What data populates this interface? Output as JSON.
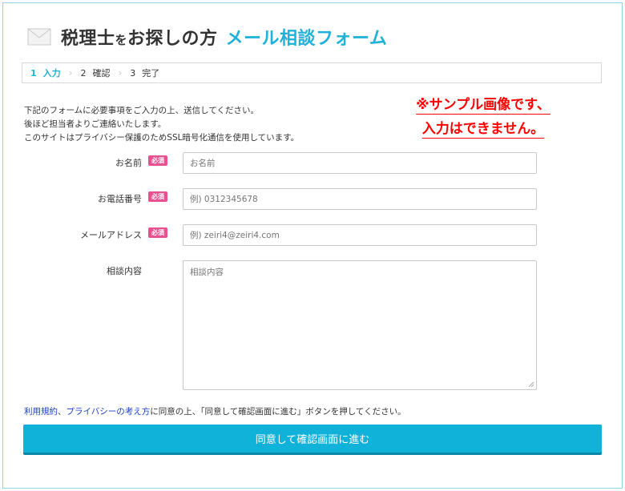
{
  "header": {
    "icon": "mail-icon",
    "title_main": "税理士",
    "title_small": "を",
    "title_main2": "お探しの方",
    "title_accent": "メール相談フォーム"
  },
  "steps": [
    {
      "num": "1",
      "label": "入力"
    },
    {
      "num": "2",
      "label": "確認"
    },
    {
      "num": "3",
      "label": "完了"
    }
  ],
  "intro": [
    "下記のフォームに必要事項をご入力の上、送信してください。",
    "後ほど担当者よりご連絡いたします。",
    "このサイトはプライバシー保護のためSSL暗号化通信を使用しています。"
  ],
  "sample_note": [
    "※サンプル画像です、",
    "入力はできません。"
  ],
  "required_badge": "必須",
  "form": {
    "name": {
      "label": "お名前",
      "placeholder": "お名前",
      "required": true
    },
    "phone": {
      "label": "お電話番号",
      "placeholder": "例) 0312345678",
      "required": true
    },
    "email": {
      "label": "メールアドレス",
      "placeholder": "例) zeiri4@zeiri4.com",
      "required": true
    },
    "message": {
      "label": "相談内容",
      "placeholder": "相談内容",
      "required": false
    }
  },
  "agreement": {
    "terms_link": "利用規約",
    "separator": "、",
    "privacy_link": "プライバシーの考え方",
    "text": "に同意の上、「同意して確認画面に進む」ボタンを押してください。"
  },
  "submit_label": "同意して確認画面に進む",
  "colors": {
    "accent": "#1fb2d8",
    "button": "#10b2d9",
    "required": "#e8508f",
    "note": "#ff0000",
    "link": "#1a3fc4"
  }
}
